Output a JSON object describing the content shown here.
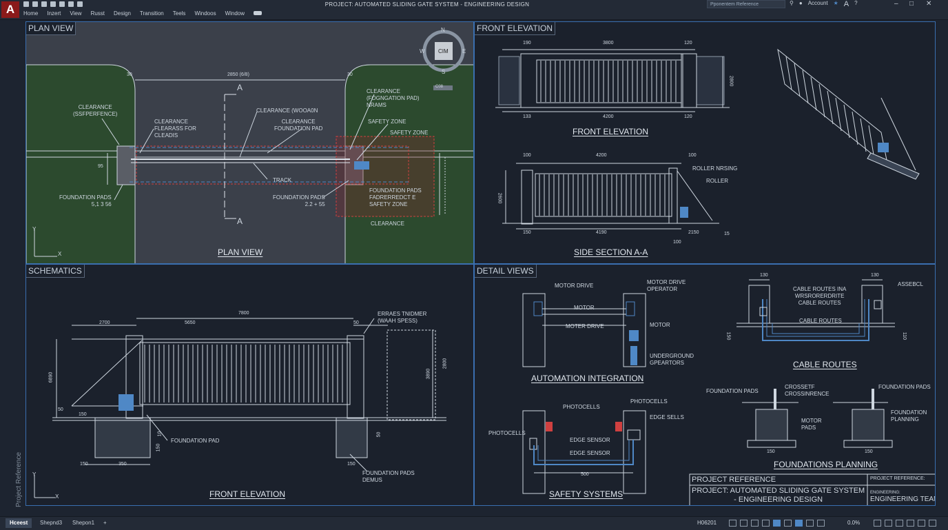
{
  "app": {
    "logo_letter": "A",
    "title": "PROJECT: AUTOMATED SLIDING GATE SYSTEM - ENGINEERING DESIGN",
    "menu": [
      "Home",
      "Inzert",
      "View",
      "Russt",
      "Design",
      "Transition",
      "Teels",
      "Windoos",
      "Window"
    ],
    "search_placeholder": "Pponentem Reference",
    "account": "Account",
    "text_a": "A"
  },
  "viewports": {
    "plan": {
      "label": "PLAN VIEW",
      "caption": "PLAN VIEW",
      "compass": {
        "n": "N",
        "s": "S",
        "e": "E",
        "w": "W",
        "center": "CIM"
      },
      "dims": {
        "left": "30",
        "mid": "2850 (6/8)",
        "right": "30",
        "side": "95"
      },
      "section_mark": "A",
      "notes": {
        "clearance_ref": "CLEARANCE\n(SSFPERFENCE)",
        "clearance_fleas": "CLEARANCE\nFLEARASS FOR\nCLEADIS",
        "clearance_woo": "CLEARANCE (WOOA0N",
        "clearance_found": "CLEARANCE\nFOUNDATION PAD",
        "clearance_pad": "CLEARANCE\n(FOGNGATION PAD)\nNRAMS",
        "safety_zone_1": "SAFETY ZONE",
        "safety_zone_2": "SAFETY ZONE",
        "track": "TRACK",
        "found_pads_left": "FOUNDATION PADS\n5,1 3 56",
        "found_pads_mid": "FOUNDATION PADS\n2.2 + 55",
        "found_pads_right": "FOUNDATION PADS\nFADRERREDCT E\nSAFETY ZONE",
        "clearance_bottom": "CLEARANCE",
        "small_tag": "C08"
      }
    },
    "front": {
      "label": "FRONT ELEVATION",
      "caption1": "FRONT ELEVATION",
      "caption2": "SIDE SECTION A-A",
      "dims1": {
        "a": "190",
        "b": "3800",
        "c": "120",
        "d": "133",
        "e": "4200",
        "f": "120",
        "h": "2800"
      },
      "dims2": {
        "a": "100",
        "b": "4200",
        "c": "100",
        "d": "150",
        "e": "4190",
        "f": "2150",
        "g": "100",
        "h": "2600",
        "i": "15"
      },
      "notes": {
        "roller_nrsing": "ROLLER NRSING",
        "roller": "ROLLER"
      }
    },
    "schematics": {
      "label": "SCHEMATICS",
      "caption": "FRONT ELEVATION",
      "dims": {
        "top": "7800",
        "a": "2700",
        "b": "5650",
        "c": "50",
        "h1": "6890",
        "h2": "3890",
        "h3": "2800",
        "base1": "150",
        "base2": "350",
        "base3": "150",
        "side1": "50",
        "side2": "150",
        "side3": "10",
        "side4": "50"
      },
      "notes": {
        "tag": "ERRAES TNIDMER\n(WAAH SPESS)",
        "found_pad": "FOUNDATION PAD",
        "found_pads": "FOUNDATION PADS\nDEMUS",
        "side_small": "150"
      }
    },
    "detail": {
      "label": "DETAIL VIEWS",
      "automation": {
        "caption": "AUTOMATION INTEGRATION",
        "motor_drive": "MOTOR DRIVE",
        "motor": "MOTOR",
        "motor_drive2": "MOTER DRIVE",
        "operator": "MOTOR DRIVE\nOPERATOR",
        "motor_r": "MOTOR",
        "underground": "UNDERGROUND\nGPEARTORS"
      },
      "cable": {
        "caption": "CABLE ROUTES",
        "dim1": "130",
        "dim2": "130",
        "notes1": "CABLE ROUTES INA\nWRSRORERDRITE\nCABLE ROUTES",
        "notes2": "CABLE ROUTES",
        "assebcl": "ASSEBCL",
        "side1": "150",
        "side2": "110"
      },
      "safety": {
        "caption": "SAFETY SYSTEMS",
        "photo1": "PHOTOCELLS",
        "photo2": "PHOTOCELLS",
        "photo3": "PHOTOCELLS",
        "edge1": "EDGE SENSOR",
        "edge2": "EDGE SENSOR",
        "edge3": "EDGE SELLS",
        "dim": "500"
      },
      "foundations": {
        "caption": "FOUNDATIONS PLANNING",
        "fp1": "FOUNDATION PADS",
        "cross": "CROSSETF\nCROSSINRENCE",
        "fp2": "FOUNDATION PADS",
        "motor_pads": "MOTOR\nPADS",
        "fp3": "FOUNDATION\nPLANNING",
        "d1": "150",
        "d2": "150"
      },
      "title_block": {
        "ref_label": "PROJECT REFERENCE",
        "project": "PROJECT: AUTOMATED SLIDING GATE SYSTEM\n- ENGINEERING DESIGN",
        "ref_label2": "PROJECT REFERENCE:",
        "engineering": "ENGINEERING:",
        "team": "ENGINEERING TEAM"
      }
    }
  },
  "side_label": "Project Reference",
  "statusbar": {
    "tabs": [
      "Hceest",
      "Shepnd3",
      "Shepon1"
    ],
    "add": "+",
    "coord": "H06201",
    "zoom": "0.0%"
  }
}
